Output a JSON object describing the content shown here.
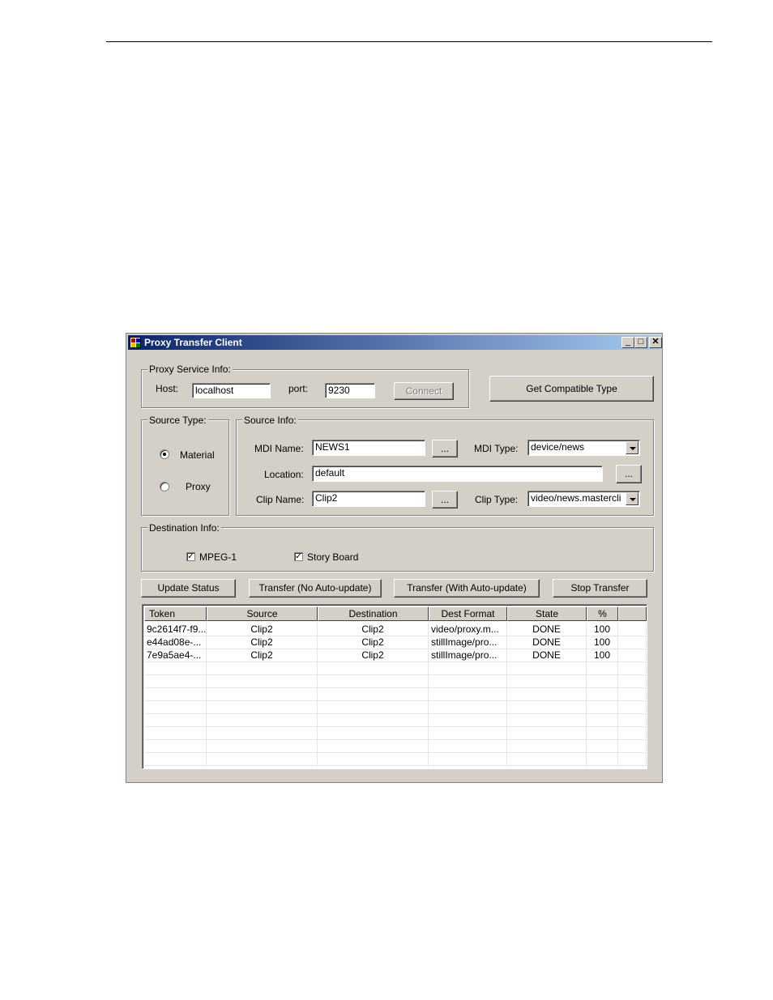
{
  "window": {
    "title": "Proxy Transfer Client",
    "minimize": "_",
    "maximize": "□",
    "close": "✕"
  },
  "proxy_service": {
    "legend": "Proxy Service Info:",
    "host_label": "Host:",
    "host_value": "localhost",
    "port_label": "port:",
    "port_value": "9230",
    "connect_label": "Connect"
  },
  "compatible_button": "Get Compatible Type",
  "source_type": {
    "legend": "Source Type:",
    "material": "Material",
    "proxy": "Proxy",
    "selected": "Material"
  },
  "source_info": {
    "legend": "Source Info:",
    "mdi_name_label": "MDI Name:",
    "mdi_name_value": "NEWS1",
    "mdi_type_label": "MDI Type:",
    "mdi_type_value": "device/news",
    "location_label": "Location:",
    "location_value": "default",
    "clip_name_label": "Clip Name:",
    "clip_name_value": "Clip2",
    "clip_type_label": "Clip Type:",
    "clip_type_value": "video/news.mastercli",
    "browse_label": "..."
  },
  "destination_info": {
    "legend": "Destination Info:",
    "mpeg1_label": "MPEG-1",
    "storyboard_label": "Story Board",
    "mpeg1_checked": true,
    "storyboard_checked": true
  },
  "actions": {
    "update_status": "Update Status",
    "transfer_no_auto": "Transfer (No Auto-update)",
    "transfer_with_auto": "Transfer (With Auto-update)",
    "stop_transfer": "Stop Transfer"
  },
  "table": {
    "columns": [
      "Token",
      "Source",
      "Destination",
      "Dest Format",
      "State",
      "%"
    ],
    "rows": [
      [
        "9c2614f7-f9...",
        "Clip2",
        "Clip2",
        "video/proxy.m...",
        "DONE",
        "100"
      ],
      [
        "e44ad08e-...",
        "Clip2",
        "Clip2",
        "stillImage/pro...",
        "DONE",
        "100"
      ],
      [
        "7e9a5ae4-...",
        "Clip2",
        "Clip2",
        "stillImage/pro...",
        "DONE",
        "100"
      ]
    ]
  },
  "icon_names": {
    "app": "app-icon",
    "minimize": "minimize-icon",
    "maximize": "maximize-icon",
    "close": "close-icon",
    "dropdown": "chevron-down-icon",
    "check": "check-icon"
  }
}
